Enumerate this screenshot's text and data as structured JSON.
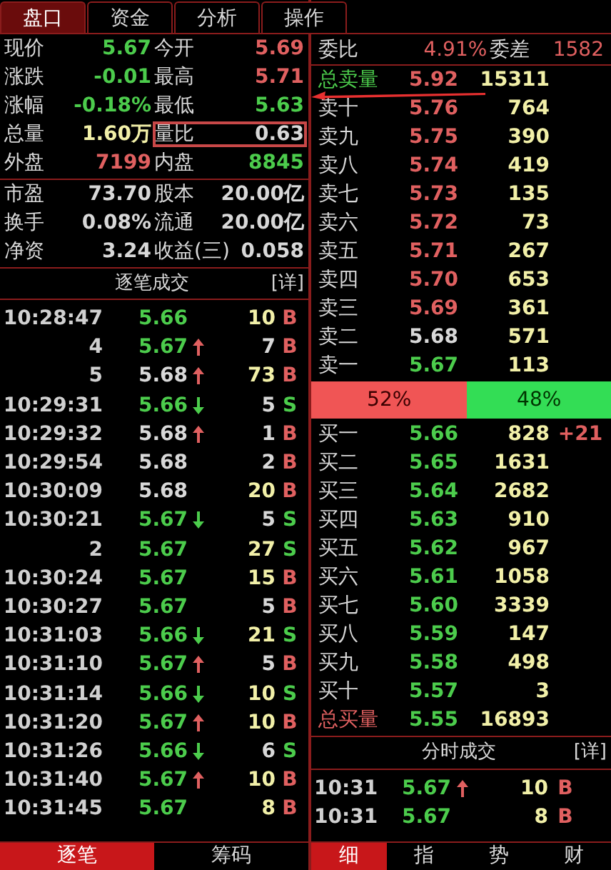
{
  "left_tabs": [
    {
      "label": "盘口",
      "selected": true
    },
    {
      "label": "资金",
      "selected": false
    },
    {
      "label": "分析",
      "selected": false
    },
    {
      "label": "操作",
      "selected": false
    }
  ],
  "quote_groups": [
    [
      [
        {
          "label": "现价",
          "value": "5.67",
          "color": "#4ccc4c"
        },
        {
          "label": "今开",
          "value": "5.69",
          "color": "#e06060"
        }
      ],
      [
        {
          "label": "涨跌",
          "value": "-0.01",
          "color": "#4ccc4c"
        },
        {
          "label": "最高",
          "value": "5.71",
          "color": "#e06060"
        }
      ],
      [
        {
          "label": "涨幅",
          "value": "-0.18%",
          "color": "#4ccc4c"
        },
        {
          "label": "最低",
          "value": "5.63",
          "color": "#4ccc4c"
        }
      ],
      [
        {
          "label": "总量",
          "value": "1.60万",
          "color": "#f2f0a8"
        },
        {
          "label": "量比",
          "value": "0.63",
          "color": "#d8d8d8",
          "highlighted": true
        }
      ],
      [
        {
          "label": "外盘",
          "value": "7199",
          "color": "#e06060"
        },
        {
          "label": "内盘",
          "value": "8845",
          "color": "#4ccc4c"
        }
      ]
    ],
    [
      [
        {
          "label": "市盈",
          "value": "73.70",
          "color": "#d8d8d8"
        },
        {
          "label": "股本",
          "value": "20.00亿",
          "color": "#d8d8d8"
        }
      ],
      [
        {
          "label": "换手",
          "value": "0.08%",
          "color": "#d8d8d8"
        },
        {
          "label": "流通",
          "value": "20.00亿",
          "color": "#d8d8d8"
        }
      ],
      [
        {
          "label": "净资",
          "value": "3.24",
          "color": "#d8d8d8"
        },
        {
          "label": "收益(三)",
          "value": "0.058",
          "color": "#d8d8d8"
        }
      ]
    ]
  ],
  "trades_panel": {
    "title": "逐笔成交",
    "detail": "[详]"
  },
  "trades": [
    {
      "time": "10:28:47",
      "price": "5.66",
      "unchanged": false,
      "kind": "level",
      "volume": "10",
      "large": true,
      "side": "B",
      "color": "#e06060"
    },
    {
      "time": "4",
      "price": "5.67",
      "unchanged": false,
      "kind": "rising",
      "volume": "7",
      "large": false,
      "side": "B",
      "color": "#e06060"
    },
    {
      "time": "5",
      "price": "5.68",
      "unchanged": true,
      "kind": "rising",
      "volume": "73",
      "large": true,
      "side": "B",
      "color": "#e06060"
    },
    {
      "time": "10:29:31",
      "price": "5.66",
      "unchanged": false,
      "kind": "falling",
      "volume": "5",
      "large": false,
      "side": "S",
      "color": "#4ccc4c"
    },
    {
      "time": "10:29:32",
      "price": "5.68",
      "unchanged": true,
      "kind": "rising",
      "volume": "1",
      "large": false,
      "side": "B",
      "color": "#e06060"
    },
    {
      "time": "10:29:54",
      "price": "5.68",
      "unchanged": true,
      "kind": "level",
      "volume": "2",
      "large": false,
      "side": "B",
      "color": "#e06060"
    },
    {
      "time": "10:30:09",
      "price": "5.68",
      "unchanged": true,
      "kind": "level",
      "volume": "20",
      "large": true,
      "side": "B",
      "color": "#e06060"
    },
    {
      "time": "10:30:21",
      "price": "5.67",
      "unchanged": false,
      "kind": "falling",
      "volume": "5",
      "large": false,
      "side": "S",
      "color": "#4ccc4c"
    },
    {
      "time": "2",
      "price": "5.67",
      "unchanged": false,
      "kind": "level",
      "volume": "27",
      "large": true,
      "side": "S",
      "color": "#4ccc4c"
    },
    {
      "time": "10:30:24",
      "price": "5.67",
      "unchanged": false,
      "kind": "level",
      "volume": "15",
      "large": true,
      "side": "B",
      "color": "#e06060"
    },
    {
      "time": "10:30:27",
      "price": "5.67",
      "unchanged": false,
      "kind": "level",
      "volume": "5",
      "large": false,
      "side": "B",
      "color": "#e06060"
    },
    {
      "time": "10:31:03",
      "price": "5.66",
      "unchanged": false,
      "kind": "falling",
      "volume": "21",
      "large": true,
      "side": "S",
      "color": "#4ccc4c"
    },
    {
      "time": "10:31:10",
      "price": "5.67",
      "unchanged": false,
      "kind": "rising",
      "volume": "5",
      "large": false,
      "side": "B",
      "color": "#e06060"
    },
    {
      "time": "10:31:14",
      "price": "5.66",
      "unchanged": false,
      "kind": "falling",
      "volume": "10",
      "large": true,
      "side": "S",
      "color": "#4ccc4c"
    },
    {
      "time": "10:31:20",
      "price": "5.67",
      "unchanged": false,
      "kind": "rising",
      "volume": "10",
      "large": true,
      "side": "B",
      "color": "#e06060"
    },
    {
      "time": "10:31:26",
      "price": "5.66",
      "unchanged": false,
      "kind": "falling",
      "volume": "6",
      "large": false,
      "side": "S",
      "color": "#4ccc4c"
    },
    {
      "time": "10:31:40",
      "price": "5.67",
      "unchanged": false,
      "kind": "rising",
      "volume": "10",
      "large": true,
      "side": "B",
      "color": "#e06060"
    },
    {
      "time": "10:31:45",
      "price": "5.67",
      "unchanged": false,
      "kind": "level",
      "volume": "8",
      "large": true,
      "side": "B",
      "color": "#e06060"
    }
  ],
  "left_bottom_tabs": [
    {
      "label": "逐笔",
      "selected": true
    },
    {
      "label": "筹码",
      "selected": false
    }
  ],
  "order_ratio": {
    "label": "委比",
    "value": "4.91%",
    "diff_label": "委差",
    "diff": "1582"
  },
  "sell_total": {
    "label": "总卖量",
    "price": "5.92",
    "volume": "15311"
  },
  "asks": [
    {
      "label": "卖十",
      "price": "5.76",
      "color": "#e06060",
      "volume": "764"
    },
    {
      "label": "卖九",
      "price": "5.75",
      "color": "#e06060",
      "volume": "390"
    },
    {
      "label": "卖八",
      "price": "5.74",
      "color": "#e06060",
      "volume": "419"
    },
    {
      "label": "卖七",
      "price": "5.73",
      "color": "#e06060",
      "volume": "135"
    },
    {
      "label": "卖六",
      "price": "5.72",
      "color": "#e06060",
      "volume": "73"
    },
    {
      "label": "卖五",
      "price": "5.71",
      "color": "#e06060",
      "volume": "267"
    },
    {
      "label": "卖四",
      "price": "5.70",
      "color": "#e06060",
      "volume": "653"
    },
    {
      "label": "卖三",
      "price": "5.69",
      "color": "#e06060",
      "volume": "361"
    },
    {
      "label": "卖二",
      "price": "5.68",
      "color": "#d8d8d8",
      "volume": "571"
    },
    {
      "label": "卖一",
      "price": "5.67",
      "color": "#4ccc4c",
      "volume": "113"
    }
  ],
  "balance_bar": {
    "level": 0.52,
    "buy_text": "52%",
    "sell_text": "48%"
  },
  "bids": [
    {
      "label": "买一",
      "price": "5.66",
      "color": "#4ccc4c",
      "volume": "828",
      "change": "+21"
    },
    {
      "label": "买二",
      "price": "5.65",
      "color": "#4ccc4c",
      "volume": "1631"
    },
    {
      "label": "买三",
      "price": "5.64",
      "color": "#4ccc4c",
      "volume": "2682"
    },
    {
      "label": "买四",
      "price": "5.63",
      "color": "#4ccc4c",
      "volume": "910"
    },
    {
      "label": "买五",
      "price": "5.62",
      "color": "#4ccc4c",
      "volume": "967"
    },
    {
      "label": "买六",
      "price": "5.61",
      "color": "#4ccc4c",
      "volume": "1058"
    },
    {
      "label": "买七",
      "price": "5.60",
      "color": "#4ccc4c",
      "volume": "3339"
    },
    {
      "label": "买八",
      "price": "5.59",
      "color": "#4ccc4c",
      "volume": "147"
    },
    {
      "label": "买九",
      "price": "5.58",
      "color": "#4ccc4c",
      "volume": "498"
    },
    {
      "label": "买十",
      "price": "5.57",
      "color": "#4ccc4c",
      "volume": "3"
    }
  ],
  "buy_total": {
    "label": "总买量",
    "price": "5.55",
    "volume": "16893"
  },
  "minute_panel": {
    "title": "分时成交",
    "detail": "[详]"
  },
  "minute_trades": [
    {
      "time": "10:31",
      "price": "5.67",
      "kind": "rising",
      "volume": "10",
      "side": "B",
      "color": "#e06060"
    },
    {
      "time": "10:31",
      "price": "5.67",
      "kind": "level",
      "volume": "8",
      "side": "B",
      "color": "#e06060"
    }
  ],
  "right_bottom_tabs": [
    {
      "label": "细",
      "selected": true
    },
    {
      "label": "指",
      "selected": false
    },
    {
      "label": "势",
      "selected": false
    },
    {
      "label": "财",
      "selected": false
    }
  ]
}
